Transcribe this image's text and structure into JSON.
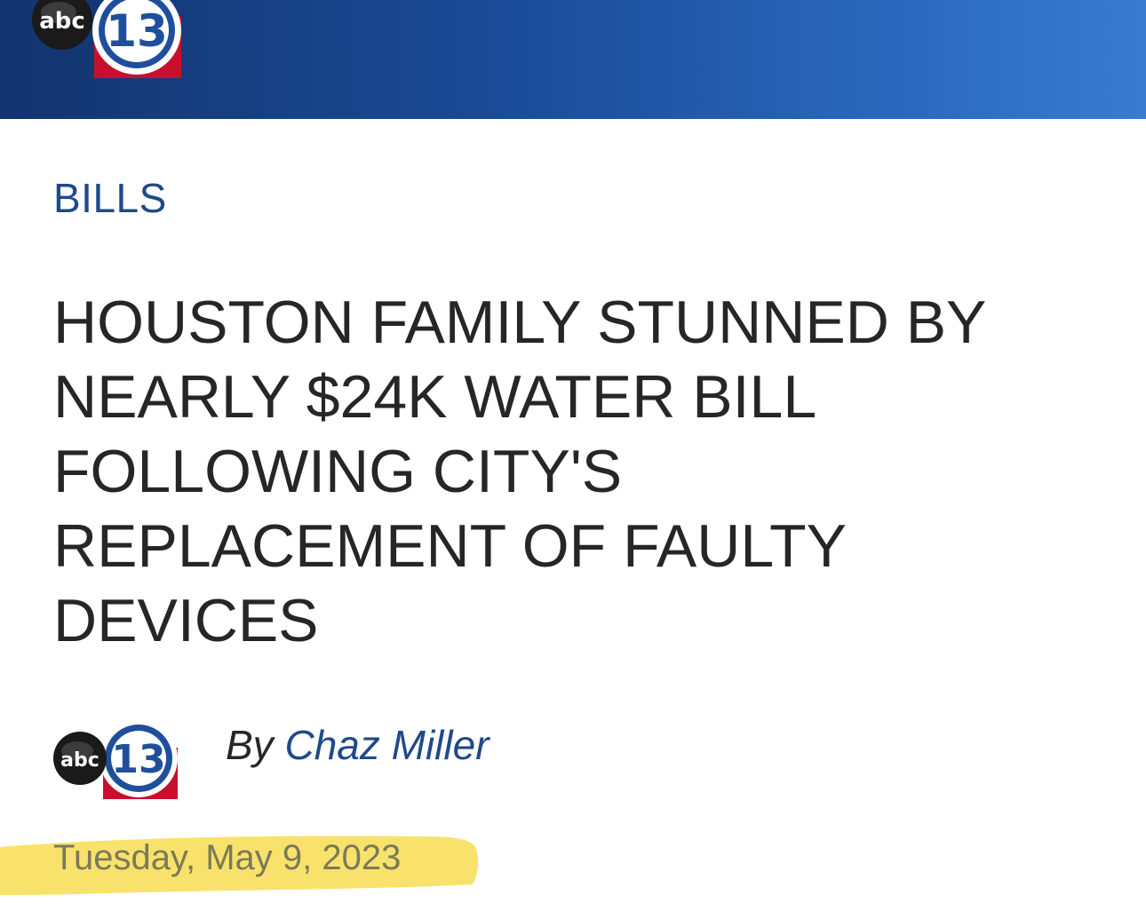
{
  "header": {
    "logo": {
      "text": "abc13",
      "icon": "abc13-logo",
      "colors": [
        "#ffffff",
        "#1b4c99",
        "#c8102e"
      ]
    },
    "background": "#1b4c99"
  },
  "article": {
    "category": "BILLS",
    "headline_lines": [
      "HOUSTON FAMILY STUNNED BY",
      "NEARLY $24K WATER BILL",
      "FOLLOWING CITY'S",
      "REPLACEMENT OF FAULTY",
      "DEVICES"
    ],
    "byline": {
      "prefix": "By",
      "author": "Chaz Miller",
      "logo": "abc13-logo"
    },
    "date": "Tuesday, May 9, 2023",
    "date_highlight_color": "#f7dd52"
  },
  "colors": {
    "link": "#1f4a8a",
    "text": "#262626",
    "date_text": "#7b7a58"
  }
}
